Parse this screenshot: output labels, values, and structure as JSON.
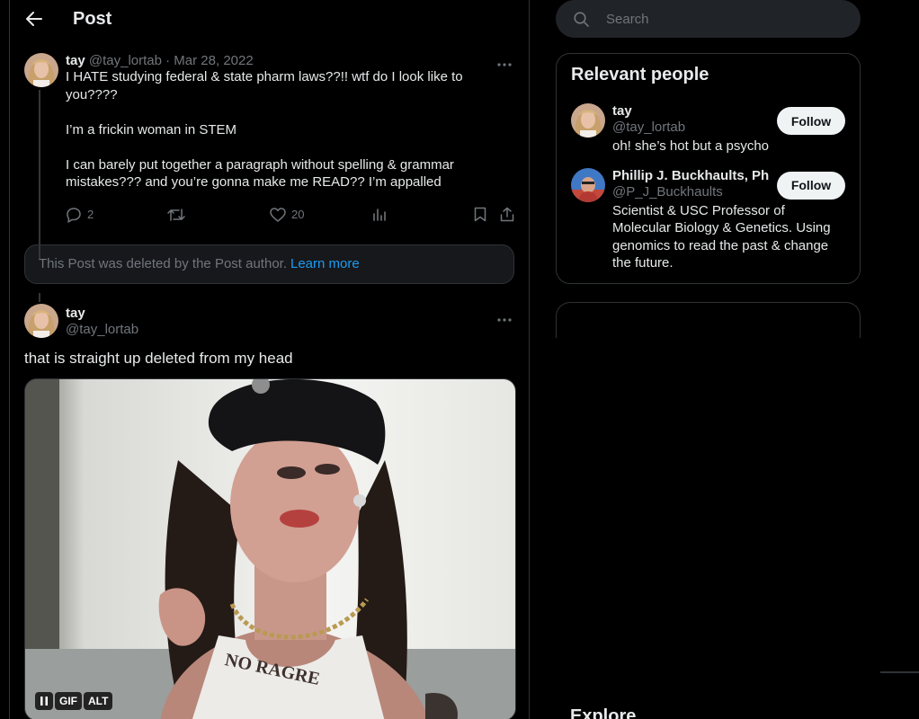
{
  "topbar": {
    "title": "Post"
  },
  "post1": {
    "name": "tay",
    "handle": "@tay_lortab",
    "date": "· Mar 28, 2022",
    "paragraphs": [
      [
        "I HATE studying federal & state pharm laws??!! wtf do I look like to you????"
      ],
      [
        "I’m a frickin woman in STEM"
      ],
      [
        "I can barely put together a paragraph without spelling & grammar",
        "mistakes??? and you’re gonna make me READ?? I’m appalled"
      ]
    ],
    "replies": "2",
    "likes": "20"
  },
  "deleted": {
    "text": "This Post was deleted by the Post author.",
    "link": "Learn more"
  },
  "post2": {
    "name": "tay",
    "handle": "@tay_lortab",
    "text": "that is straight up deleted from my head",
    "badges": {
      "gif": "GIF",
      "alt": "ALT"
    },
    "tattoo_text": "NO RAGRE"
  },
  "search": {
    "placeholder": "Search"
  },
  "relevant": {
    "title": "Relevant people",
    "people": [
      {
        "name": "tay",
        "handle": "@tay_lortab",
        "bio": "oh! she’s hot but a psycho",
        "button": "Follow"
      },
      {
        "name": "Phillip J. Buckhaults, Ph.D.",
        "handle": "@P_J_Buckhaults",
        "bio": "Scientist & USC Professor of Molecular Biology & Genetics. Using genomics to read the past & change the future.",
        "button": "Follow"
      }
    ]
  },
  "explore": {
    "title": "Explore"
  },
  "colors": {
    "accent": "#1d9bf0",
    "background": "#000000",
    "border": "#2f3336",
    "muted": "#71767b"
  }
}
